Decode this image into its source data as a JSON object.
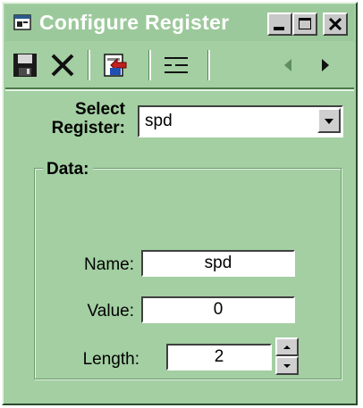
{
  "window": {
    "title": "Configure Register",
    "colors": {
      "background": "#a3cfa2",
      "title_text": "#ffffff",
      "field": "#ffffff"
    }
  },
  "caption_buttons": [
    {
      "name": "minimize-button",
      "icon": "minimize-icon"
    },
    {
      "name": "maximize-button",
      "icon": "maximize-icon"
    },
    {
      "name": "close-window-button",
      "icon": "close-icon"
    }
  ],
  "toolbar": {
    "buttons": [
      "save-icon",
      "delete-icon",
      "import-icon",
      "properties-list-icon",
      "previous-arrow-icon",
      "next-arrow-icon"
    ]
  },
  "register_select": {
    "label": "Select\nRegister:",
    "value": "spd"
  },
  "data_group": {
    "label": "Data:",
    "name": {
      "label": "Name:",
      "value": "spd"
    },
    "value": {
      "label": "Value:",
      "value": "0"
    },
    "length": {
      "label": "Length:",
      "value": "2"
    }
  }
}
